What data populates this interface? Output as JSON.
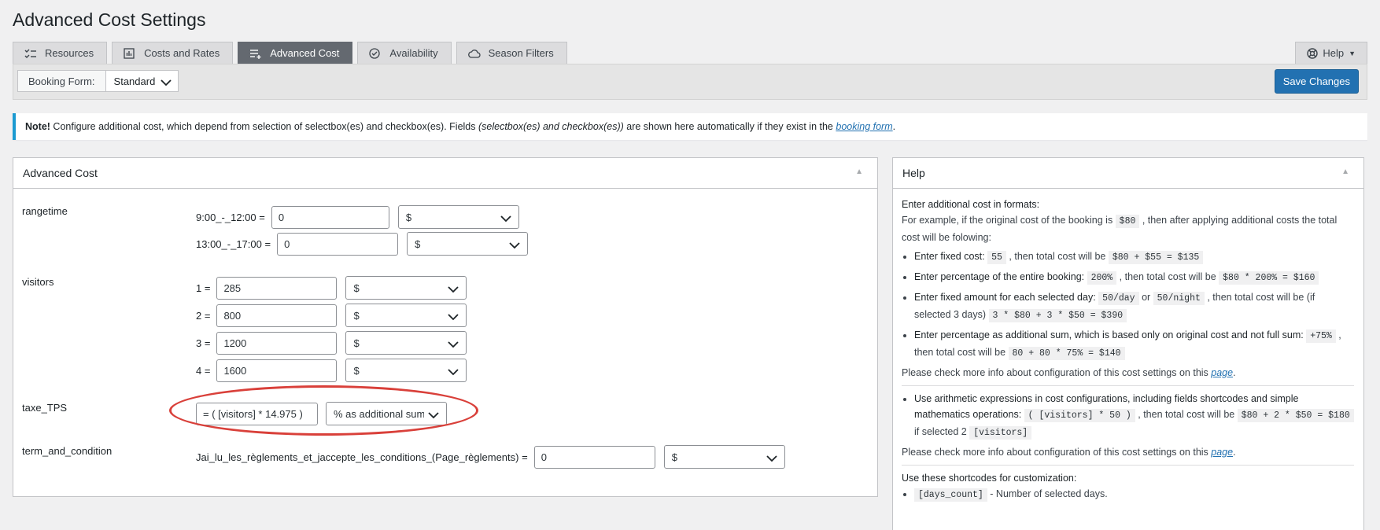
{
  "page": {
    "title": "Advanced Cost Settings"
  },
  "tabs": [
    {
      "label": "Resources",
      "icon": "list-check-icon",
      "active": false
    },
    {
      "label": "Costs and Rates",
      "icon": "chart-icon",
      "active": false
    },
    {
      "label": "Advanced Cost",
      "icon": "list-add-icon",
      "active": true
    },
    {
      "label": "Availability",
      "icon": "check-circle-icon",
      "active": false
    },
    {
      "label": "Season Filters",
      "icon": "cloud-icon",
      "active": false
    }
  ],
  "help_tab": {
    "label": "Help",
    "icon": "lifebuoy-icon"
  },
  "toolbar": {
    "booking_form_label": "Booking Form:",
    "booking_form_value": "Standard",
    "save_label": "Save Changes"
  },
  "notice": {
    "prefix": "Note!",
    "text1": " Configure additional cost, which depend from selection of selectbox(es) and checkbox(es). Fields ",
    "italic": "(selectbox(es) and checkbox(es))",
    "text2": " are shown here automatically if they exist in the ",
    "link": "booking form",
    "end": "."
  },
  "advanced_cost": {
    "title": "Advanced Cost",
    "sections": {
      "rangetime": {
        "label": "rangetime",
        "rows": [
          {
            "label": "9:00_-_12:00 =",
            "value": "0",
            "unit": "$"
          },
          {
            "label": "13:00_-_17:00 =",
            "value": "0",
            "unit": "$"
          }
        ]
      },
      "visitors": {
        "label": "visitors",
        "rows": [
          {
            "label": "1 =",
            "value": "285",
            "unit": "$"
          },
          {
            "label": "2 =",
            "value": "800",
            "unit": "$"
          },
          {
            "label": "3 =",
            "value": "1200",
            "unit": "$"
          },
          {
            "label": "4 =",
            "value": "1600",
            "unit": "$"
          }
        ]
      },
      "taxe": {
        "label": "taxe_TPS",
        "value": "= ( [visitors] * 14.975 )",
        "unit": "% as additional sum"
      },
      "terms": {
        "label": "term_and_condition",
        "row_label": "Jai_lu_les_règlements_et_jaccepte_les_conditions_(Page_règlements) =",
        "value": "0",
        "unit": "$"
      }
    }
  },
  "help_panel": {
    "title": "Help",
    "intro_title": "Enter additional cost in formats:",
    "intro1": "For example, if the original cost of the booking is ",
    "intro_code": "$80",
    "intro2": " , then after applying additional costs the total cost will be folowing:",
    "items": {
      "fixed": {
        "t": "Enter fixed cost: ",
        "c1": "55",
        "m": " , then total cost will be ",
        "c2": "$80 + $55 = $135"
      },
      "percent": {
        "t": "Enter percentage of the entire booking: ",
        "c1": "200%",
        "m": " , then total cost will be ",
        "c2": "$80 * 200% = $160"
      },
      "perday": {
        "t": "Enter fixed amount for each selected day: ",
        "c1": "50/day",
        "or": " or ",
        "c2": "50/night",
        "m": " , then total cost will be (if selected 3 days) ",
        "c3": "3 * $80 + 3 * $50 = $390"
      },
      "addsum": {
        "t": "Enter percentage as additional sum, which is based only on original cost and not full sum: ",
        "c1": "+75%",
        "m": " , then total cost will be ",
        "c2": "80 + 80 * 75% = $140"
      }
    },
    "more1": "Please check more info about configuration of this cost settings on this ",
    "more_link": "page",
    "arith": {
      "t": "Use arithmetic expressions in cost configurations, including fields shortcodes and simple mathematics operations: ",
      "c1": "( [visitors] * 50 )",
      "m": " , then total cost will be ",
      "c2": "$80 + 2 * $50 = $180",
      "m2": " if selected 2 ",
      "c3": "[visitors]"
    },
    "more2": "Please check more info about configuration of this cost settings on this ",
    "more2_link": "page",
    "shortcodes_title": "Use these shortcodes for customization:",
    "shortcode_code": "[days_count]",
    "shortcode_desc": " - Number of selected days."
  }
}
